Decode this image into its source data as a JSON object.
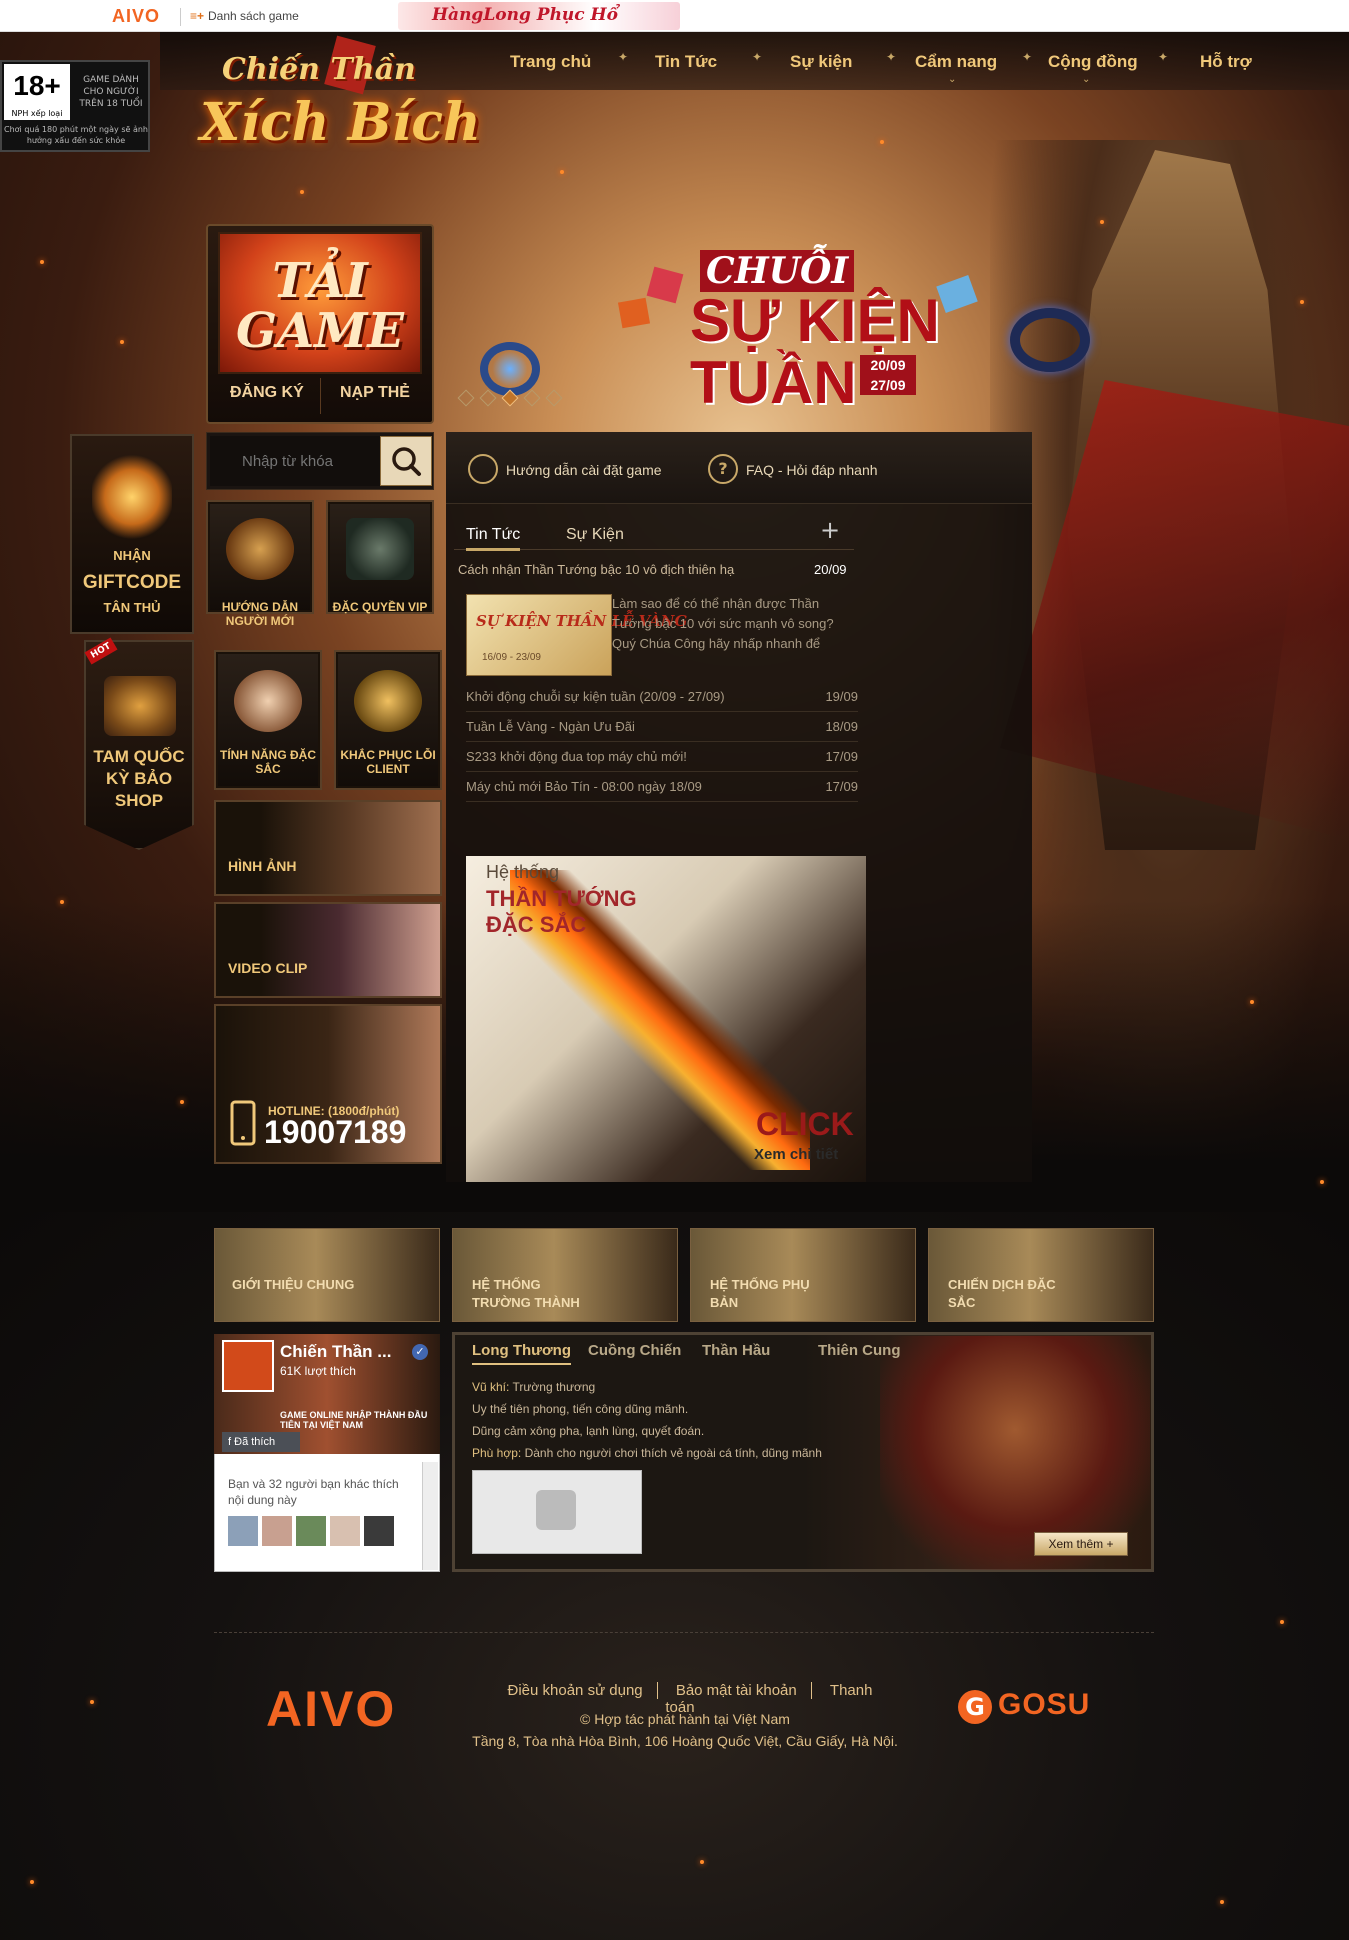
{
  "topbar": {
    "brand": "AIVO",
    "game_list_icon": "list-plus-icon",
    "game_list_label": "Danh sách game",
    "partner_banner": "HàngLong Phục Hổ"
  },
  "age_rating": {
    "rating": "18+",
    "publisher_label": "NPH xếp loại",
    "notice": "GAME DÀNH CHO NGƯỜI TRÊN 18 TUỔI",
    "warning": "Chơi quá 180 phút một ngày sẽ ảnh hưởng xấu đến sức khỏe"
  },
  "logo": {
    "line1": "Chiến Thần",
    "line2": "Xích Bích"
  },
  "nav": {
    "items": [
      {
        "label": "Trang chủ",
        "has_dropdown": false
      },
      {
        "label": "Tin Tức",
        "has_dropdown": false
      },
      {
        "label": "Sự kiện",
        "has_dropdown": false
      },
      {
        "label": "Cẩm nang",
        "has_dropdown": true
      },
      {
        "label": "Cộng đồng",
        "has_dropdown": true
      },
      {
        "label": "Hỗ trợ",
        "has_dropdown": false
      }
    ]
  },
  "download": {
    "title": "TẢI GAME",
    "register": "ĐĂNG KÝ",
    "topup": "NẠP THẺ"
  },
  "banner": {
    "line1": "CHUỖI",
    "line2": "SỰ KIỆN",
    "line3": "TUẦN",
    "date_from": "20/09",
    "date_to": "27/09",
    "slide_count": 5,
    "active_slide": 3
  },
  "giftcode": {
    "line1": "NHẬN",
    "line2": "GIFTCODE",
    "line3": "TÂN THỦ"
  },
  "shop": {
    "badge": "HOT",
    "line1": "TAM QUỐC",
    "line2": "KỲ BẢO",
    "line3": "SHOP"
  },
  "search": {
    "placeholder": "Nhập từ khóa",
    "icon": "search-icon"
  },
  "tiles": {
    "guide": "HƯỚNG DẪN NGƯỜI MỚI",
    "vip": "ĐẶC QUYỀN VIP",
    "features": "TÍNH NĂNG ĐẶC SẮC",
    "client_fix": "KHẮC PHỤC LỖI CLIENT",
    "images": "HÌNH ẢNH",
    "video": "VIDEO CLIP",
    "hotline_label": "HOTLINE: (1800đ/phút)",
    "hotline_number": "19007189"
  },
  "quicklinks": {
    "install": "Hướng dẫn cài đặt game",
    "faq": "FAQ - Hỏi đáp nhanh"
  },
  "news": {
    "tabs": [
      "Tin Tức",
      "Sự Kiện"
    ],
    "active_tab": 0,
    "more_icon": "plus-icon",
    "featured": {
      "title": "Cách nhận Thần Tướng bậc 10 vô địch thiên hạ",
      "date": "20/09",
      "image_caption": "SỰ KIỆN THẦN LỄ VÀNG",
      "image_dates": "16/09 - 23/09",
      "summary": "Làm sao để có thể nhận được Thần Tướng bậc 10 với sức mạnh vô song? Quý Chúa Công hãy nhấp nhanh để"
    },
    "items": [
      {
        "title": "Khởi động chuỗi sự kiện tuần (20/09 - 27/09)",
        "date": "19/09"
      },
      {
        "title": "Tuần Lễ Vàng - Ngàn Ưu Đãi",
        "date": "18/09"
      },
      {
        "title": "S233 khởi động đua top máy chủ mới!",
        "date": "17/09"
      },
      {
        "title": "Máy chủ mới Bảo Tín - 08:00 ngày 18/09",
        "date": "17/09"
      }
    ]
  },
  "promo": {
    "line1": "Hệ thống",
    "line2": "THẦN TƯỚNG",
    "line3": "ĐẶC SẮC",
    "click": "CLICK",
    "detail": "Xem chi tiết"
  },
  "features": [
    {
      "label": "GIỚI THIỆU CHUNG"
    },
    {
      "label": "HỆ THỐNG TRƯỜNG THÀNH"
    },
    {
      "label": "HỆ THỐNG PHỤ BẢN"
    },
    {
      "label": "CHIẾN DỊCH ĐẶC SẮC"
    }
  ],
  "facebook": {
    "page_name": "Chiến Thần ...",
    "likes": "61K lượt thích",
    "liked_button": "Đã thích",
    "friends_text": "Bạn và 32 người bạn khác thích nội dung này",
    "verified_icon": "verified-check-icon",
    "banner_text": "GAME ONLINE NHẬP THÀNH ĐẦU TIÊN TẠI VIỆT NAM"
  },
  "classes": {
    "tabs": [
      "Long Thương",
      "Cuồng Chiến",
      "Thần Hầu",
      "Thiên Cung"
    ],
    "active_tab": 0,
    "weapon_label": "Vũ khí:",
    "weapon": "Trường thương",
    "line2": "Uy thế tiên phong, tiến công dũng mãnh.",
    "line3": "Dũng cảm xông pha, lạnh lùng, quyết đoán.",
    "suit_label": "Phù hợp:",
    "suit": "Dành cho người chơi thích vẻ ngoài cá tính, dũng mãnh",
    "placeholder_icon": "puzzle-piece-icon",
    "more_button": "Xem thêm +"
  },
  "footer": {
    "left_logo": "AIVO",
    "links": [
      "Điều khoản sử dụng",
      "Bảo mật tài khoản",
      "Thanh toán"
    ],
    "copyright": "© Hợp tác phát hành tại Việt Nam",
    "address": "Tầng 8, Tòa nhà Hòa Bình, 106 Hoàng Quốc Việt, Cầu Giấy, Hà Nội.",
    "right_logo": "GOSU",
    "right_logo_mark": "G"
  },
  "colors": {
    "accent": "#f26522",
    "gold": "#f0c87a",
    "banner_red": "#b20f17"
  }
}
